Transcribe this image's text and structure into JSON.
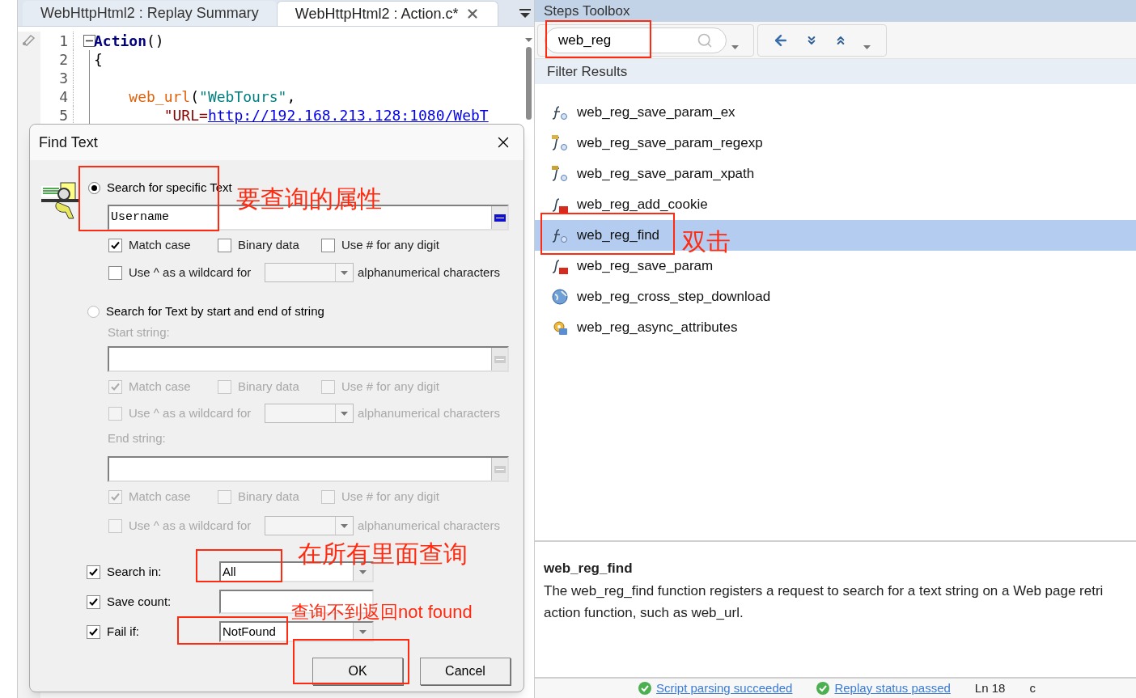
{
  "editor": {
    "tabs": [
      {
        "label": "WebHttpHtml2 : Replay Summary",
        "selected": false,
        "closable": false
      },
      {
        "label": "WebHttpHtml2 : Action.c*",
        "selected": true,
        "closable": true
      }
    ],
    "lines": [
      {
        "number": "1",
        "foldable": true,
        "segments": [
          {
            "kind": "keyword",
            "text": "Action"
          },
          {
            "kind": "plain",
            "text": "()"
          }
        ]
      },
      {
        "number": "2",
        "foldable": false,
        "segments": [
          {
            "kind": "plain",
            "text": "{"
          }
        ]
      },
      {
        "number": "3",
        "foldable": false
      },
      {
        "number": "4",
        "foldable": false,
        "segments": [
          {
            "kind": "func",
            "text": "    web_url"
          },
          {
            "kind": "plain",
            "text": "("
          },
          {
            "kind": "string",
            "text": "\"WebTours\""
          },
          {
            "kind": "plain",
            "text": ","
          }
        ]
      },
      {
        "number": "5",
        "foldable": false,
        "segments": [
          {
            "kind": "param",
            "text": "        \"URL="
          },
          {
            "kind": "link",
            "text": "http://192.168.213.128:1080/WebT"
          }
        ]
      }
    ]
  },
  "dialog": {
    "title": "Find Text",
    "specific": {
      "label": "Search for specific Text",
      "selected": true,
      "value": "Username",
      "options": {
        "checks": [
          {
            "label": "Match case",
            "checked": true
          },
          {
            "label": "Binary data",
            "checked": false
          },
          {
            "label": "Use # for any digit",
            "checked": false
          }
        ],
        "wildcard": {
          "label": "Use ^ as a wildcard for",
          "checked": false
        },
        "suffix": "alphanumerical characters"
      }
    },
    "range": {
      "label": "Search for Text by start and end of string",
      "selected": false,
      "disabled": true,
      "fields": [
        {
          "label": "Start string:",
          "options": {
            "checks": [
              {
                "label": "Match case",
                "checked": true
              },
              {
                "label": "Binary data",
                "checked": false
              },
              {
                "label": "Use # for any digit",
                "checked": false
              }
            ],
            "wildcard": {
              "label": "Use ^ as a wildcard for",
              "checked": false
            },
            "suffix": "alphanumerical characters"
          }
        },
        {
          "label": "End string:",
          "options": {
            "checks": [
              {
                "label": "Match case",
                "checked": true
              },
              {
                "label": "Binary data",
                "checked": false
              },
              {
                "label": "Use # for any digit",
                "checked": false
              }
            ],
            "wildcard": {
              "label": "Use ^ as a wildcard for",
              "checked": false
            },
            "suffix": "alphanumerical characters"
          }
        }
      ]
    },
    "settings": [
      {
        "label": "Search in:",
        "checked": true,
        "kind": "combo",
        "value": "All"
      },
      {
        "label": "Save count:",
        "checked": true,
        "kind": "text"
      },
      {
        "label": "Fail if:",
        "checked": true,
        "kind": "combo",
        "value": "NotFound"
      }
    ],
    "buttons": [
      "OK",
      "Cancel"
    ]
  },
  "toolbox": {
    "title": "Steps Toolbox",
    "search": {
      "value": "web_reg"
    },
    "results_title": "Filter Results",
    "items": [
      {
        "label": "web_reg_save_param_ex",
        "kind": "func",
        "selected": false
      },
      {
        "label": "web_reg_save_param_regexp",
        "kind": "regex",
        "selected": false
      },
      {
        "label": "web_reg_save_param_xpath",
        "kind": "xpath",
        "selected": false
      },
      {
        "label": "web_reg_add_cookie",
        "kind": "exe",
        "selected": false
      },
      {
        "label": "web_reg_find",
        "kind": "func",
        "selected": true
      },
      {
        "label": "web_reg_save_param",
        "kind": "exe",
        "selected": false
      },
      {
        "label": "web_reg_cross_step_download",
        "kind": "globe",
        "selected": false
      },
      {
        "label": "web_reg_async_attributes",
        "kind": "async",
        "selected": false
      }
    ],
    "description": {
      "title": "web_reg_find",
      "lines": [
        "The web_reg_find function registers a request to search for a text string on a Web page retri",
        "action function, such as web_url."
      ]
    }
  },
  "status_bar": {
    "items": [
      {
        "text": "Script parsing succeeded",
        "kind": "ok"
      },
      {
        "text": "Replay status passed",
        "kind": "ok"
      },
      {
        "text": "Ln 18",
        "kind": "plain"
      },
      {
        "text": "c",
        "kind": "plain"
      }
    ]
  },
  "annotations": [
    {
      "text": "要查询的属性"
    },
    {
      "text": "双击"
    },
    {
      "text": "在所有里面查询"
    },
    {
      "text": "查询不到返回not found"
    }
  ]
}
